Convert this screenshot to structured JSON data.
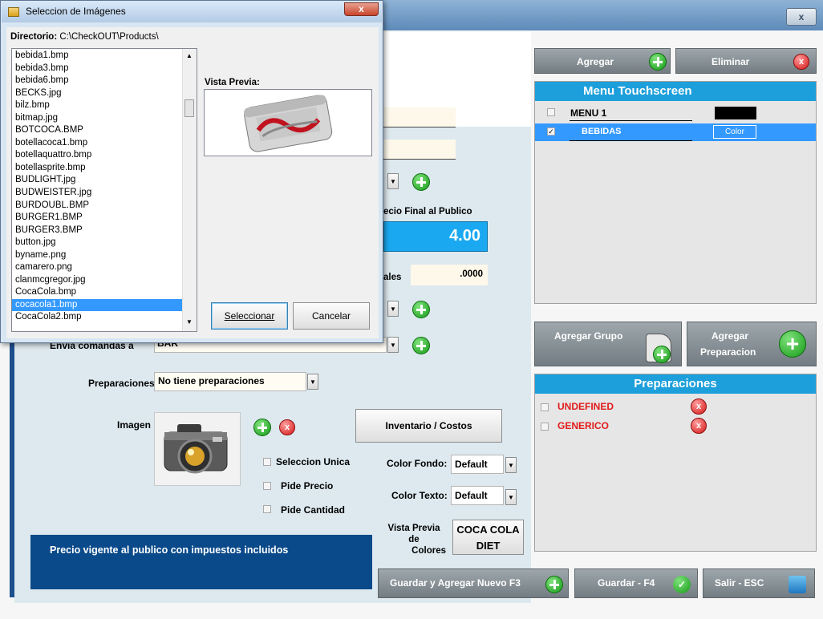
{
  "main_window": {
    "close_glyph": "x"
  },
  "form": {
    "price_final_label": "ecio Final al Publico",
    "price_final_value": "4.00",
    "ales_label": "ales",
    "ales_value": ".0000",
    "envia_label": "Envia comandas a",
    "envia_value": "BAR",
    "preparaciones_label": "Preparaciones",
    "preparaciones_value": "No tiene preparaciones",
    "imagen_label": "Imagen",
    "seleccion_unica": "Seleccion Unica",
    "pide_precio": "Pide Precio",
    "pide_cantidad": "Pide Cantidad",
    "inventario_button": "Inventario / Costos",
    "color_fondo_label": "Color Fondo:",
    "color_fondo_value": "Default",
    "color_texto_label": "Color Texto:",
    "color_texto_value": "Default",
    "vista_previa_colores_label_1": "Vista Previa de",
    "vista_previa_colores_label_2": "Colores",
    "preview_line_1": "COCA COLA",
    "preview_line_2": "DIET",
    "info_text": "Precio vigente al publico con impuestos incluidos"
  },
  "bottom_buttons": {
    "guardar_nuevo": "Guardar y Agregar Nuevo F3",
    "guardar": "Guardar - F4",
    "salir": "Salir - ESC"
  },
  "menu_panel": {
    "agregar": "Agregar",
    "eliminar": "Eliminar",
    "title": "Menu Touchscreen",
    "items": [
      {
        "label": "MENU 1",
        "checked": false,
        "color_text": ""
      },
      {
        "label": "BEBIDAS",
        "checked": true,
        "color_text": "Color"
      }
    ]
  },
  "grupo_buttons": {
    "agregar_grupo": "Agregar Grupo",
    "agregar_prep_1": "Agregar",
    "agregar_prep_2": "Preparacion"
  },
  "prep_panel": {
    "title": "Preparaciones",
    "items": [
      "UNDEFINED",
      "GENERICO"
    ]
  },
  "dialog": {
    "title": "Seleccion de Imágenes",
    "close_glyph": "x",
    "directory_label": "Directorio:",
    "directory_value": "C:\\CheckOUT\\Products\\",
    "preview_label": "Vista Previa:",
    "select_button": "Seleccionar",
    "cancel_button": "Cancelar",
    "files": [
      "bebida1.bmp",
      "bebida3.bmp",
      "bebida6.bmp",
      "BECKS.jpg",
      "bilz.bmp",
      "bitmap.jpg",
      "BOTCOCA.BMP",
      "botellacoca1.bmp",
      "botellaquattro.bmp",
      "botellasprite.bmp",
      "BUDLIGHT.jpg",
      "BUDWEISTER.jpg",
      "BURDOUBL.BMP",
      "BURGER1.BMP",
      "BURGER3.BMP",
      "button.jpg",
      "byname.png",
      "camarero.png",
      "clanmcgregor.jpg",
      "CocaCola.bmp",
      "cocacola1.bmp",
      "CocaCola2.bmp"
    ],
    "selected_file": "cocacola1.bmp"
  },
  "colors": {
    "panel_head": "#1d9fdb",
    "selection": "#3399ff",
    "info_bg": "#0a4a8a",
    "error_red": "#e21b1b"
  }
}
